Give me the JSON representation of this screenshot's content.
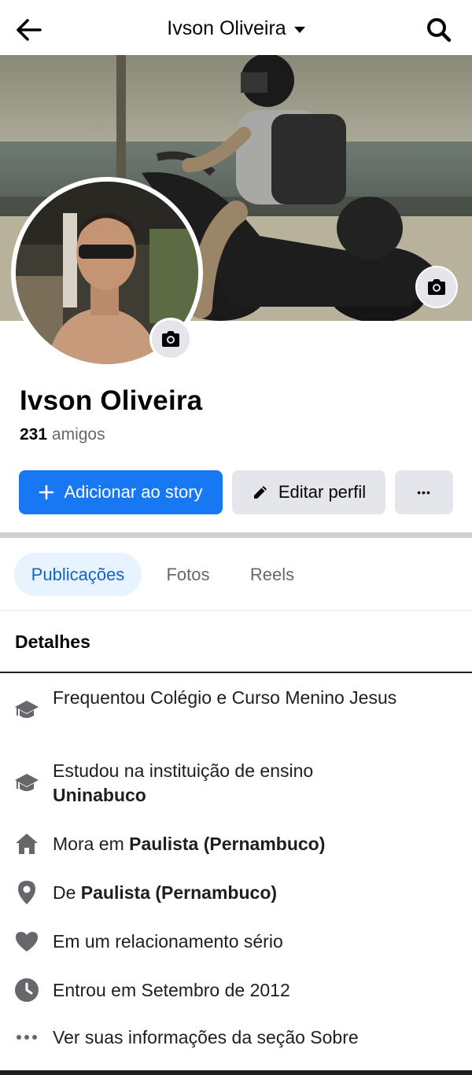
{
  "header": {
    "title": "Ivson Oliveira",
    "back_icon": "arrow-left-icon",
    "search_icon": "search-icon"
  },
  "profile": {
    "name": "Ivson Oliveira",
    "friends_count": "231",
    "friends_label": "amigos"
  },
  "actions": {
    "add_story": "Adicionar ao story",
    "edit_profile": "Editar perfil",
    "more": "•••"
  },
  "tabs": [
    {
      "label": "Publicações",
      "active": true
    },
    {
      "label": "Fotos",
      "active": false
    },
    {
      "label": "Reels",
      "active": false
    }
  ],
  "details": {
    "title": "Detalhes",
    "items": [
      {
        "icon": "graduation-cap-icon",
        "prefix": "Frequentou Colégio e Curso Menino Jesus",
        "bold": ""
      },
      {
        "icon": "graduation-cap-icon",
        "prefix": "Estudou na instituição de ensino ",
        "bold": "Uninabuco"
      },
      {
        "icon": "home-icon",
        "prefix": "Mora em ",
        "bold": "Paulista (Pernambuco)"
      },
      {
        "icon": "location-pin-icon",
        "prefix": "De ",
        "bold": "Paulista (Pernambuco)"
      },
      {
        "icon": "heart-icon",
        "prefix": "Em um relacionamento sério",
        "bold": ""
      },
      {
        "icon": "clock-icon",
        "prefix": "Entrou em Setembro de 2012",
        "bold": ""
      },
      {
        "icon": "more-dots-icon",
        "prefix": "Ver suas informações da seção Sobre",
        "bold": ""
      }
    ]
  },
  "colors": {
    "primary": "#1877f2",
    "tab_active_bg": "#e7f3ff",
    "tab_active_text": "#1463c7",
    "secondary_btn": "#e4e6eb"
  }
}
